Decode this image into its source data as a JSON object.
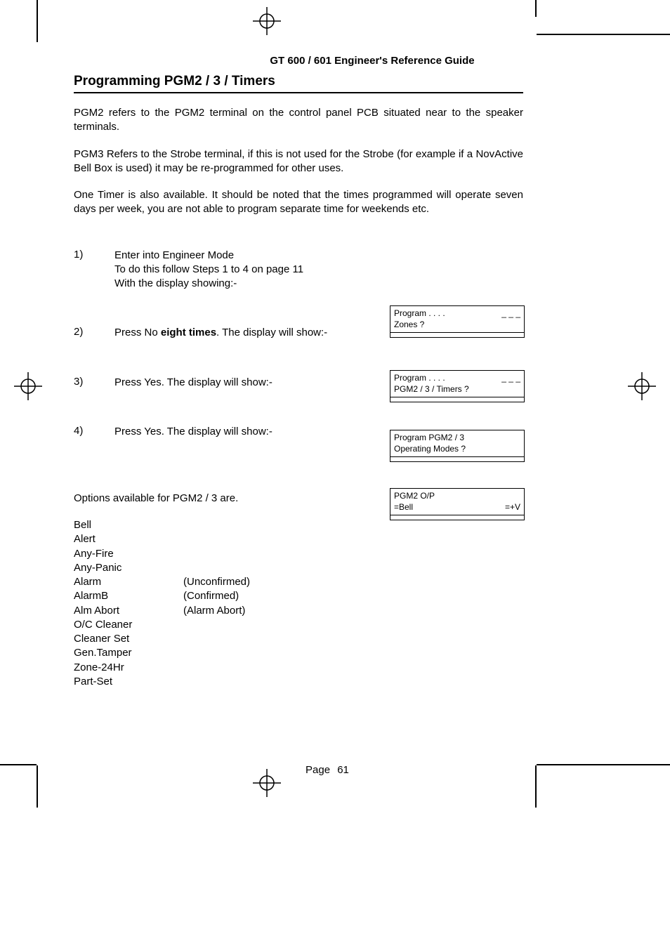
{
  "header": "GT 600 / 601 Engineer's Reference Guide",
  "title": "Programming PGM2 / 3 / Timers",
  "para1": "PGM2 refers to the PGM2 terminal on the control panel PCB situated near to the speaker terminals.",
  "para2": "PGM3 Refers to the Strobe terminal, if this is not used for the Strobe (for example if a NovActive Bell Box is used) it may be re-programmed for other uses.",
  "para3": "One Timer is also available. It should be noted that the times programmed will operate seven days per week, you are not able to program separate time for weekends etc.",
  "steps": {
    "s1": {
      "num": "1)",
      "line1": "Enter into Engineer Mode",
      "line2": "To do this follow Steps 1 to 4 on page 11",
      "line3": "With the display showing:-"
    },
    "s2": {
      "num": "2)",
      "text_pre": "Press No ",
      "text_bold": "eight times",
      "text_post": ". The display will show:-"
    },
    "s3": {
      "num": "3)",
      "text": "Press Yes. The display will show:-"
    },
    "s4": {
      "num": "4)",
      "text": "Press Yes. The display will show:-"
    }
  },
  "displays": {
    "d1": {
      "line1_left": "Program . . . .",
      "line1_right": "_ _ _",
      "line2": "Zones ?"
    },
    "d2": {
      "line1_left": "Program . . . .",
      "line1_right": "_ _ _",
      "line2": "PGM2 / 3 / Timers ?"
    },
    "d3": {
      "line1": "Program PGM2 / 3",
      "line2": "Operating Modes ?"
    },
    "d4": {
      "line1": "PGM2  O/P",
      "line2_left": "=Bell",
      "line2_right": "=+V"
    }
  },
  "options_intro": "Options available for PGM2 / 3 are.",
  "options": {
    "bell": "Bell",
    "alert": "Alert",
    "anyfire": "Any-Fire",
    "anypanic": "Any-Panic",
    "alarm": "Alarm",
    "alarm_note": "(Unconfirmed)",
    "alarmb": "AlarmB",
    "alarmb_note": "(Confirmed)",
    "almabort": "Alm Abort",
    "almabort_note": "(Alarm Abort)",
    "occleaner": "O/C Cleaner",
    "cleanerset": "Cleaner Set",
    "gentamper": "Gen.Tamper",
    "zone24hr": "Zone-24Hr",
    "partset": "Part-Set"
  },
  "page_label": "Page",
  "page_number": "61"
}
